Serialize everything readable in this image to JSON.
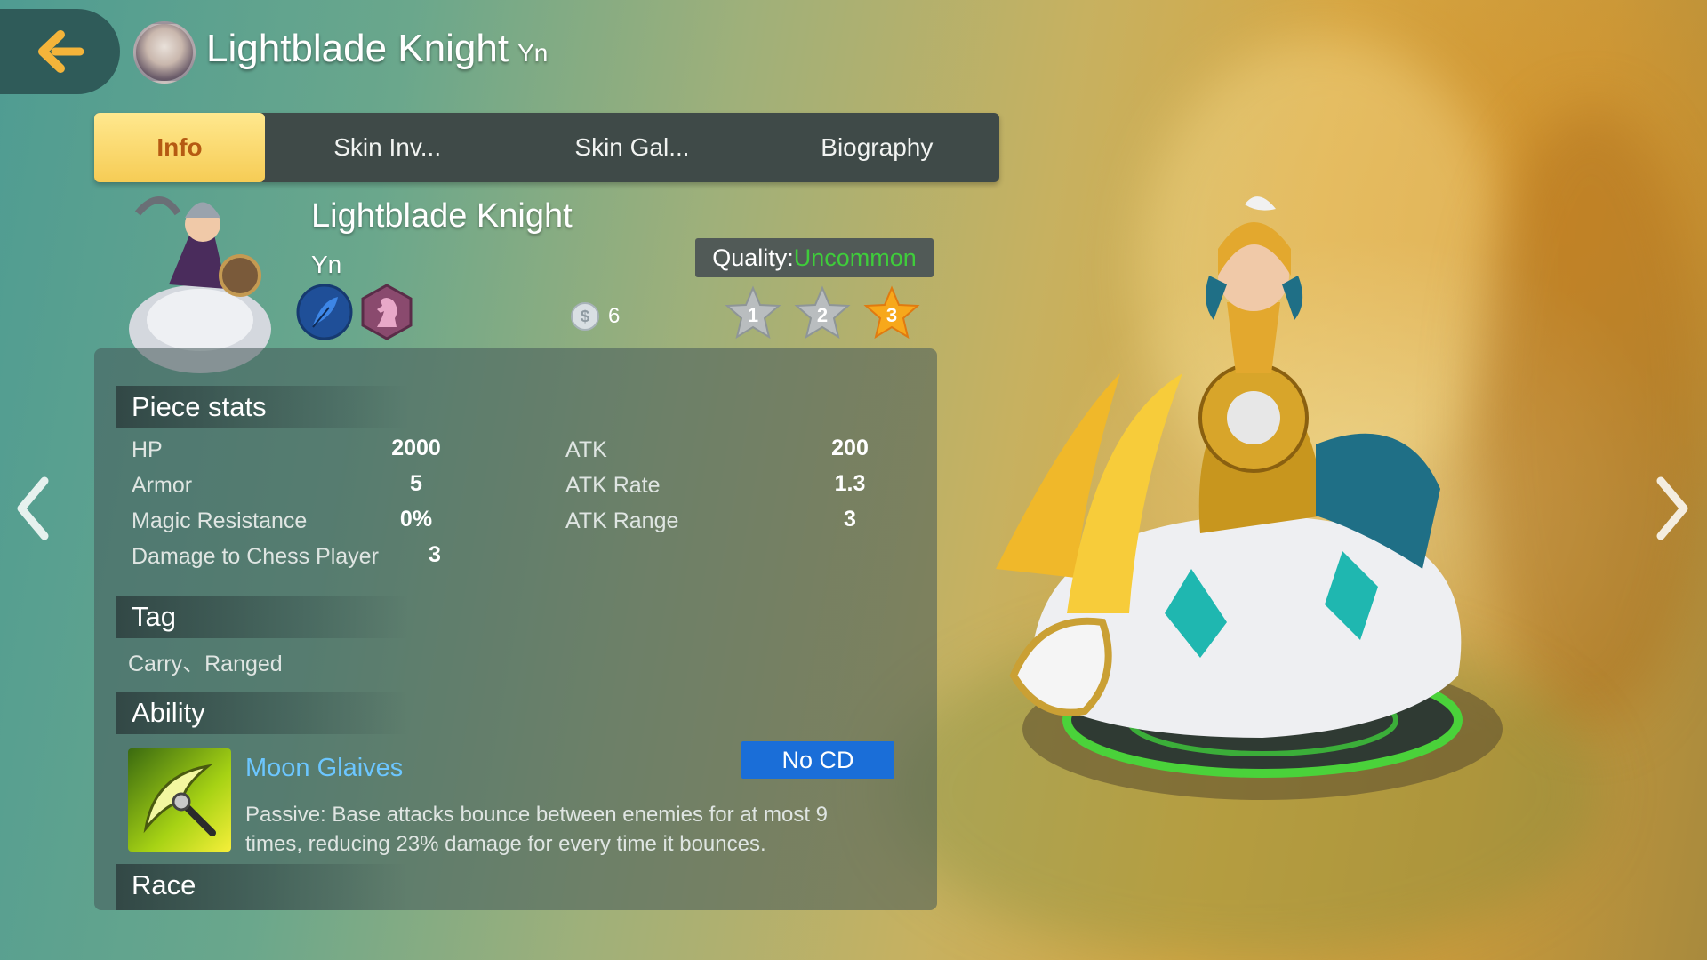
{
  "header": {
    "title": "Lightblade Knight",
    "subtitle": "Yn"
  },
  "tabs": [
    {
      "label": "Info",
      "active": true
    },
    {
      "label": "Skin Inv..."
    },
    {
      "label": "Skin Gal..."
    },
    {
      "label": "Biography"
    }
  ],
  "hero": {
    "name": "Lightblade Knight",
    "race": "Yn",
    "cost": "6",
    "quality_label": "Quality:",
    "quality_value": "Uncommon",
    "quality_color": "#3fcc3b",
    "stars": [
      "1",
      "2",
      "3"
    ],
    "selected_star": "3",
    "traits": [
      "feather-trait-icon",
      "knight-trait-icon"
    ]
  },
  "stats": {
    "heading": "Piece stats",
    "left": [
      {
        "label": "HP",
        "value": "2000"
      },
      {
        "label": "Armor",
        "value": "5"
      },
      {
        "label": "Magic Resistance",
        "value": "0%"
      },
      {
        "label": "Damage to Chess Player",
        "value": "3"
      }
    ],
    "right": [
      {
        "label": "ATK",
        "value": "200"
      },
      {
        "label": "ATK Rate",
        "value": "1.3"
      },
      {
        "label": "ATK Range",
        "value": "3"
      }
    ]
  },
  "tag": {
    "heading": "Tag",
    "text": "Carry、Ranged"
  },
  "ability": {
    "heading": "Ability",
    "name": "Moon Glaives",
    "cooldown": "No CD",
    "description": "Passive: Base attacks bounce between enemies for at most 9 times, reducing 23% damage for every time it bounces."
  },
  "race_section": {
    "heading": "Race"
  },
  "colors": {
    "tab_active": "#f6cc55",
    "ability_name": "#6cc6ff",
    "cd_badge": "#1a6ed8",
    "star_active": "#f7a81b",
    "star_inactive": "#b9bdbf"
  }
}
